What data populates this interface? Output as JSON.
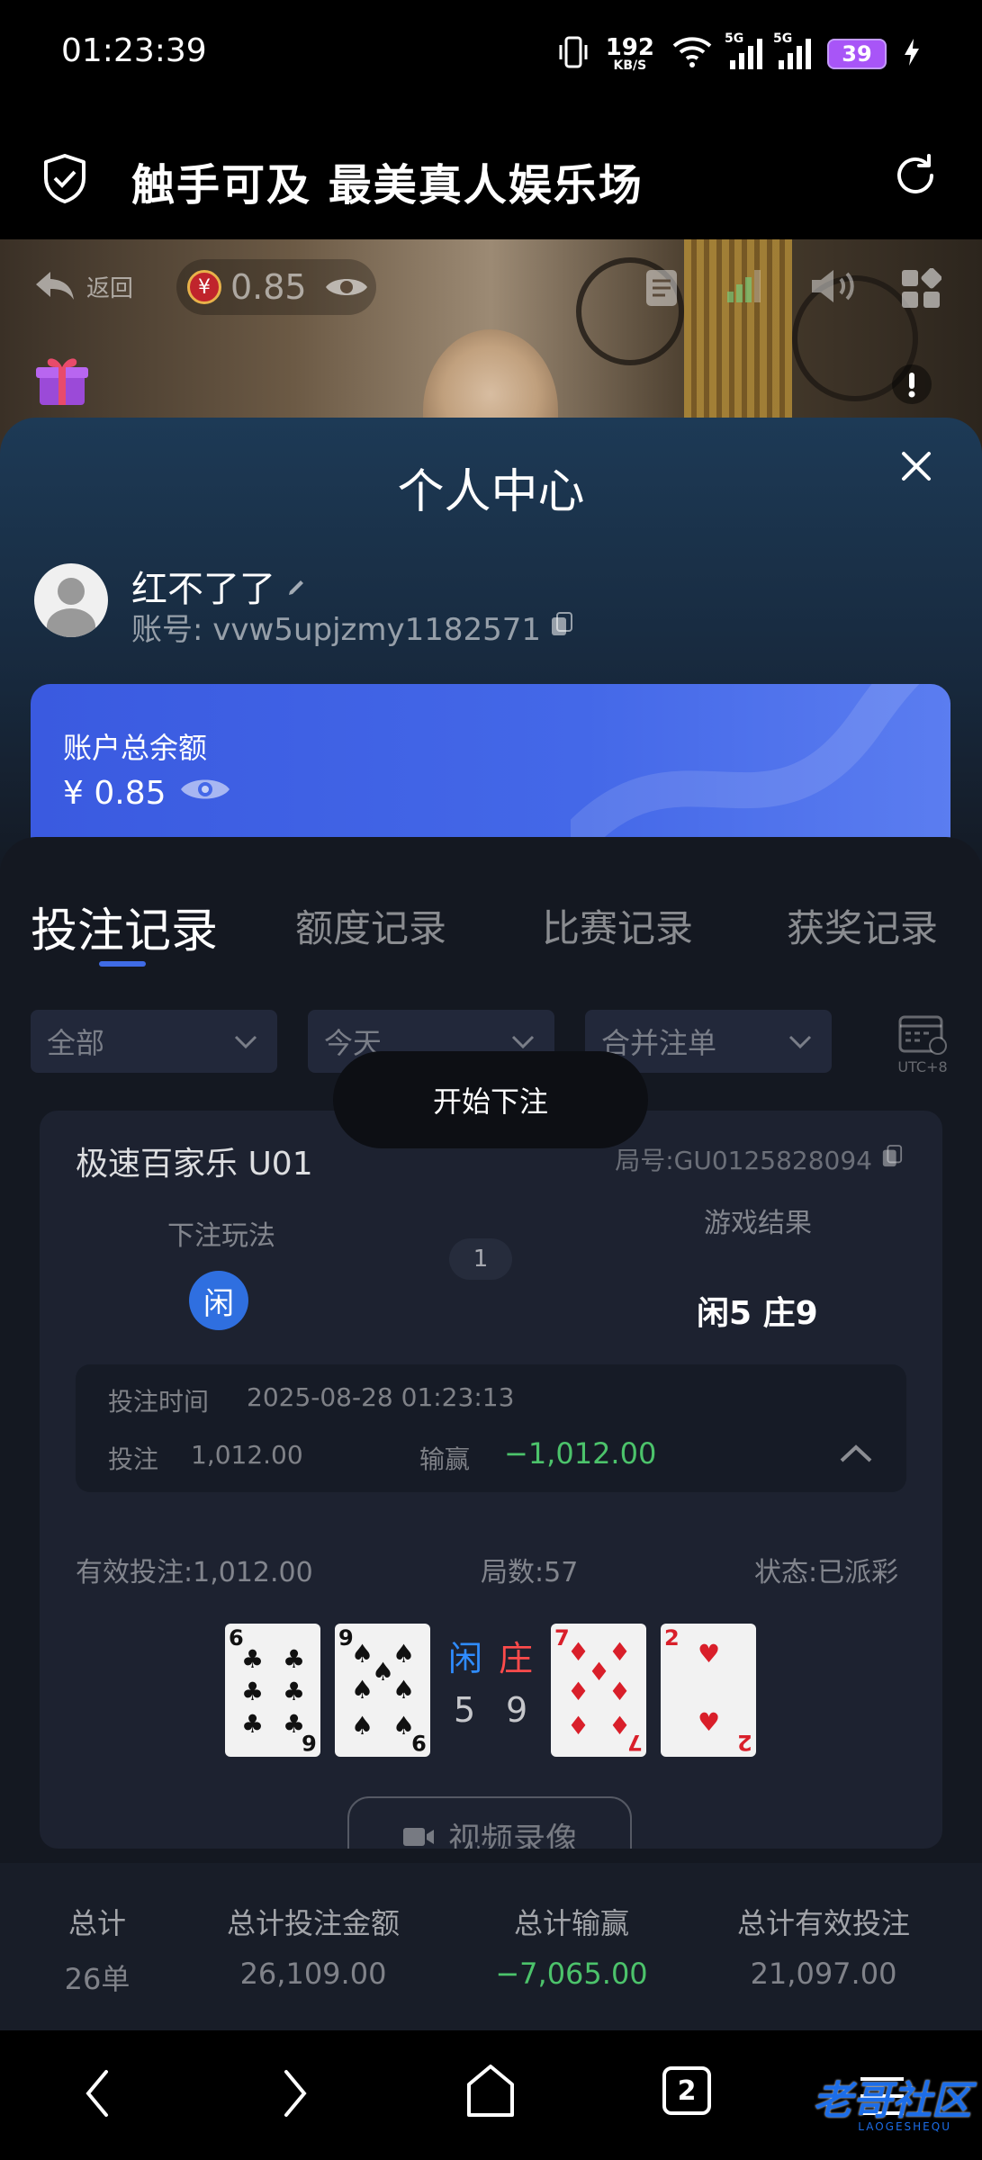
{
  "status_bar": {
    "time": "01:23:39",
    "net_speed": "192",
    "net_speed_unit": "KB/S",
    "sim1_label": "5G",
    "sim2_label": "5G",
    "battery": "39"
  },
  "app_bar": {
    "title": "触手可及 最美真人娱乐场"
  },
  "video_overlay": {
    "back_label": "返回",
    "balance": "0.85",
    "currency_symbol": "¥"
  },
  "personal_center": {
    "title": "个人中心",
    "nickname": "红不了了",
    "account": "账号: vvw5upjzmy1182571",
    "balance_label": "账户总余额",
    "balance_value": "¥ 0.85"
  },
  "tabs": [
    {
      "label": "投注记录",
      "active": true
    },
    {
      "label": "额度记录",
      "active": false
    },
    {
      "label": "比赛记录",
      "active": false
    },
    {
      "label": "获奖记录",
      "active": false
    }
  ],
  "filters": {
    "type": "全部",
    "date": "今天",
    "merge": "合并注单",
    "timezone": "UTC+8"
  },
  "toast": "开始下注",
  "record": {
    "game_name": "极速百家乐 U01",
    "round_no": "局号:GU0125828094",
    "bet_type_label": "下注玩法",
    "bet_type_chip": "闲",
    "round_count_badge": "1",
    "result_label": "游戏结果",
    "result": "闲5 庄9",
    "bet_time_label": "投注时间",
    "bet_time": "2025-08-28 01:23:13",
    "bet_label": "投注",
    "bet_amount": "1,012.00",
    "win_loss_label": "输赢",
    "win_loss": "−1,012.00",
    "valid_bet": "有效投注:1,012.00",
    "rounds": "局数:57",
    "status": "状态:已派彩",
    "player_label": "闲",
    "banker_label": "庄",
    "player_score": "5",
    "banker_score": "9",
    "cards": [
      {
        "rank": "6",
        "suit": "♣"
      },
      {
        "rank": "9",
        "suit": "♠"
      },
      {
        "rank": "7",
        "suit": "♦"
      },
      {
        "rank": "2",
        "suit": "♥"
      }
    ],
    "video_button": "视频录像"
  },
  "totals": {
    "headers": [
      "总计",
      "总计投注金额",
      "总计输赢",
      "总计有效投注"
    ],
    "values": [
      "26单",
      "26,109.00",
      "−7,065.00",
      "21,097.00"
    ]
  },
  "nav": {
    "tab_count": "2"
  },
  "watermark": {
    "text": "老哥社区",
    "sub": "LAOGESHEQU"
  },
  "colors": {
    "accent_blue": "#3f6be6",
    "loss_green": "#4cc36b",
    "player_blue": "#2f8cff",
    "banker_red": "#ff4b4b"
  }
}
